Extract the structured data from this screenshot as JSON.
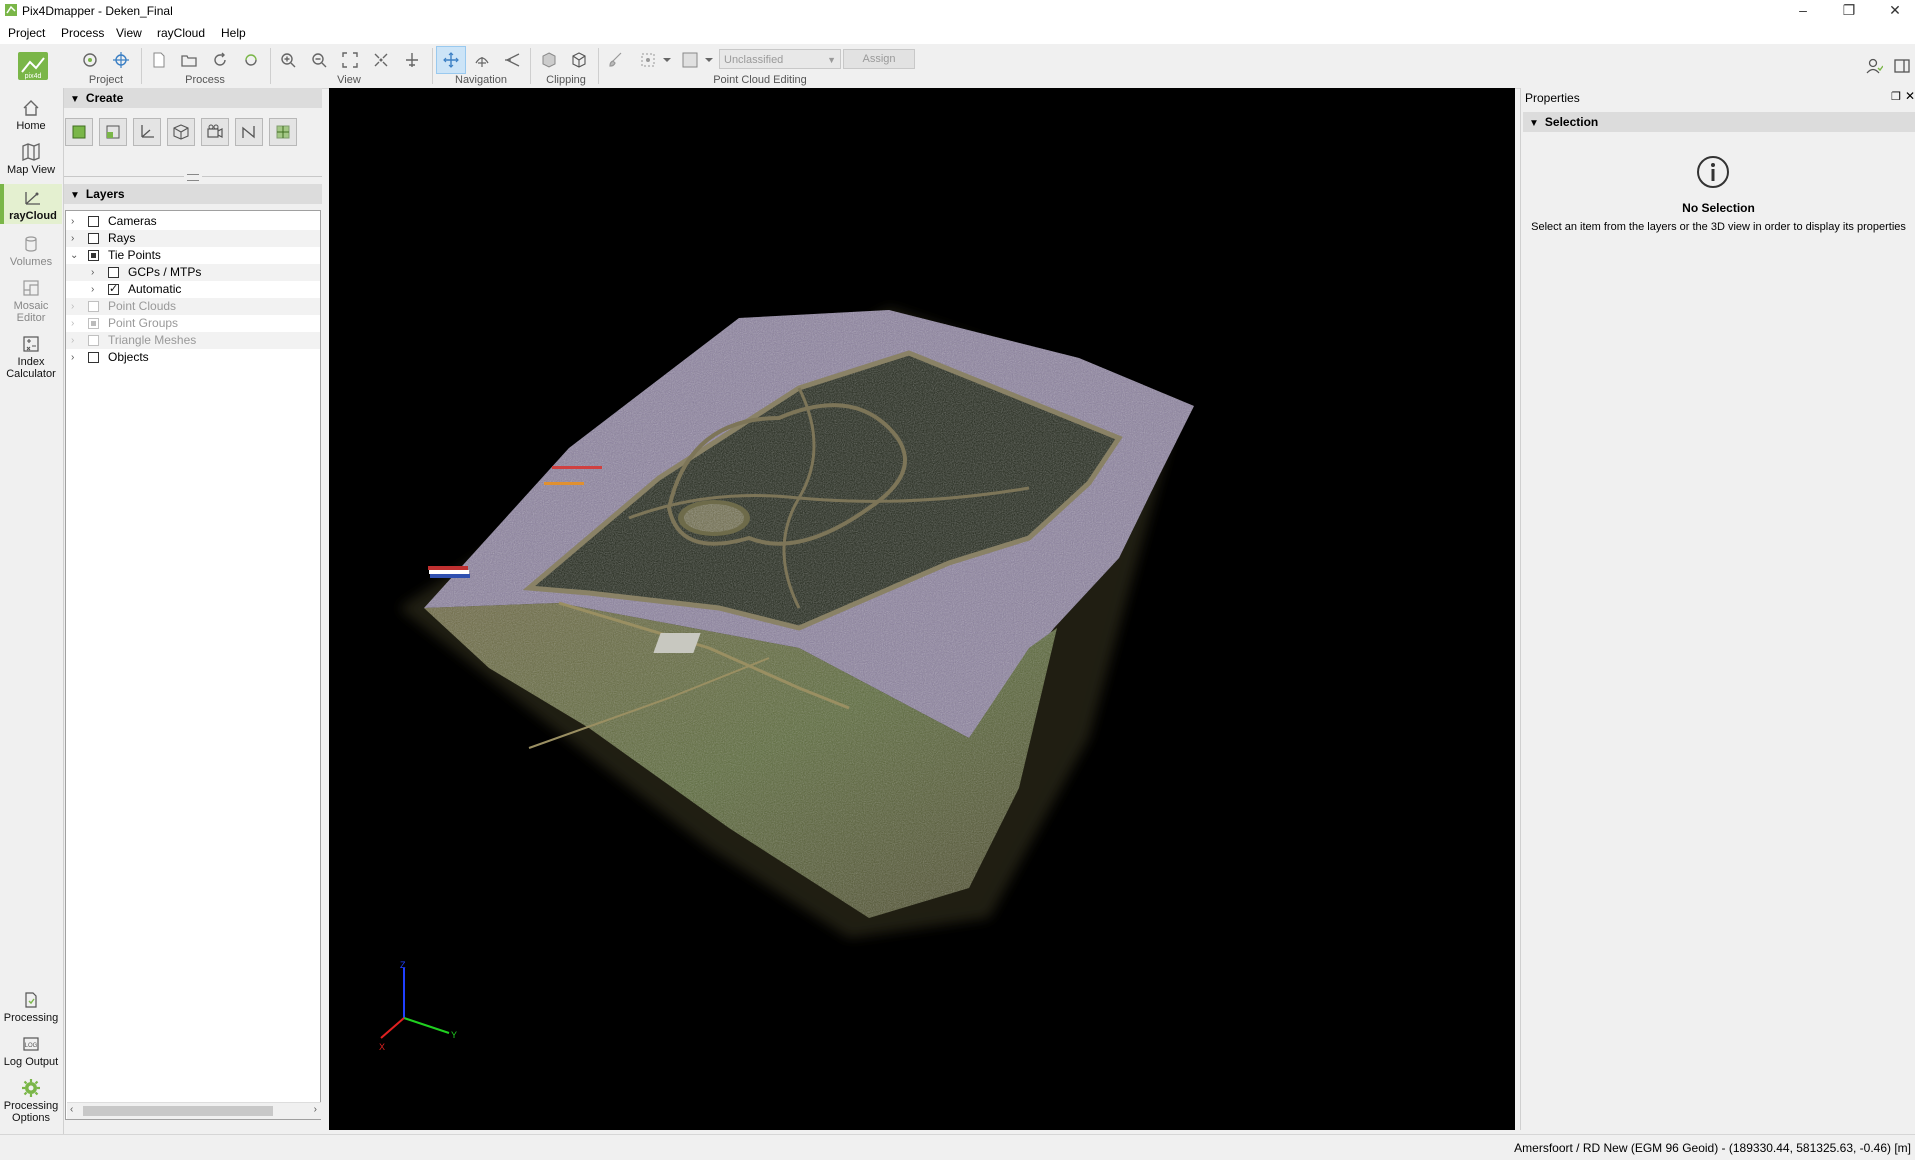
{
  "window": {
    "title": "Pix4Dmapper - Deken_Final",
    "minimize": "–",
    "restore": "❐",
    "close": "✕"
  },
  "menu": [
    "Project",
    "Process",
    "View",
    "rayCloud",
    "Help"
  ],
  "toolbar": {
    "groups": [
      "Project",
      "Process",
      "View",
      "Navigation",
      "Clipping",
      "Point Cloud Editing"
    ],
    "class_select": "Unclassified",
    "assign_label": "Assign"
  },
  "leftnav": {
    "home": "Home",
    "map_view": "Map View",
    "raycloud": "rayCloud",
    "volumes": "Volumes",
    "mosaic_editor_1": "Mosaic",
    "mosaic_editor_2": "Editor",
    "index_calc_1": "Index",
    "index_calc_2": "Calculator",
    "processing": "Processing",
    "log_output": "Log Output",
    "proc_options_1": "Processing",
    "proc_options_2": "Options"
  },
  "create": {
    "title": "Create"
  },
  "layers": {
    "title": "Layers",
    "items": [
      {
        "label": "Cameras"
      },
      {
        "label": "Rays"
      },
      {
        "label": "Tie Points"
      },
      {
        "label": "GCPs / MTPs"
      },
      {
        "label": "Automatic"
      },
      {
        "label": "Point Clouds"
      },
      {
        "label": "Point Groups"
      },
      {
        "label": "Triangle Meshes"
      },
      {
        "label": "Objects"
      }
    ]
  },
  "properties": {
    "title": "Properties",
    "section": "Selection",
    "empty_title": "No Selection",
    "empty_desc": "Select an item from the layers or the 3D view in order to display its properties"
  },
  "axes": {
    "x": "X",
    "y": "Y",
    "z": "Z"
  },
  "colors": {
    "accent": "#7ab648",
    "viewport_bg": "#000000"
  },
  "status": {
    "coords": "Amersfoort / RD New (EGM 96 Geoid) - (189330.44, 581325.63, -0.46) [m]"
  }
}
